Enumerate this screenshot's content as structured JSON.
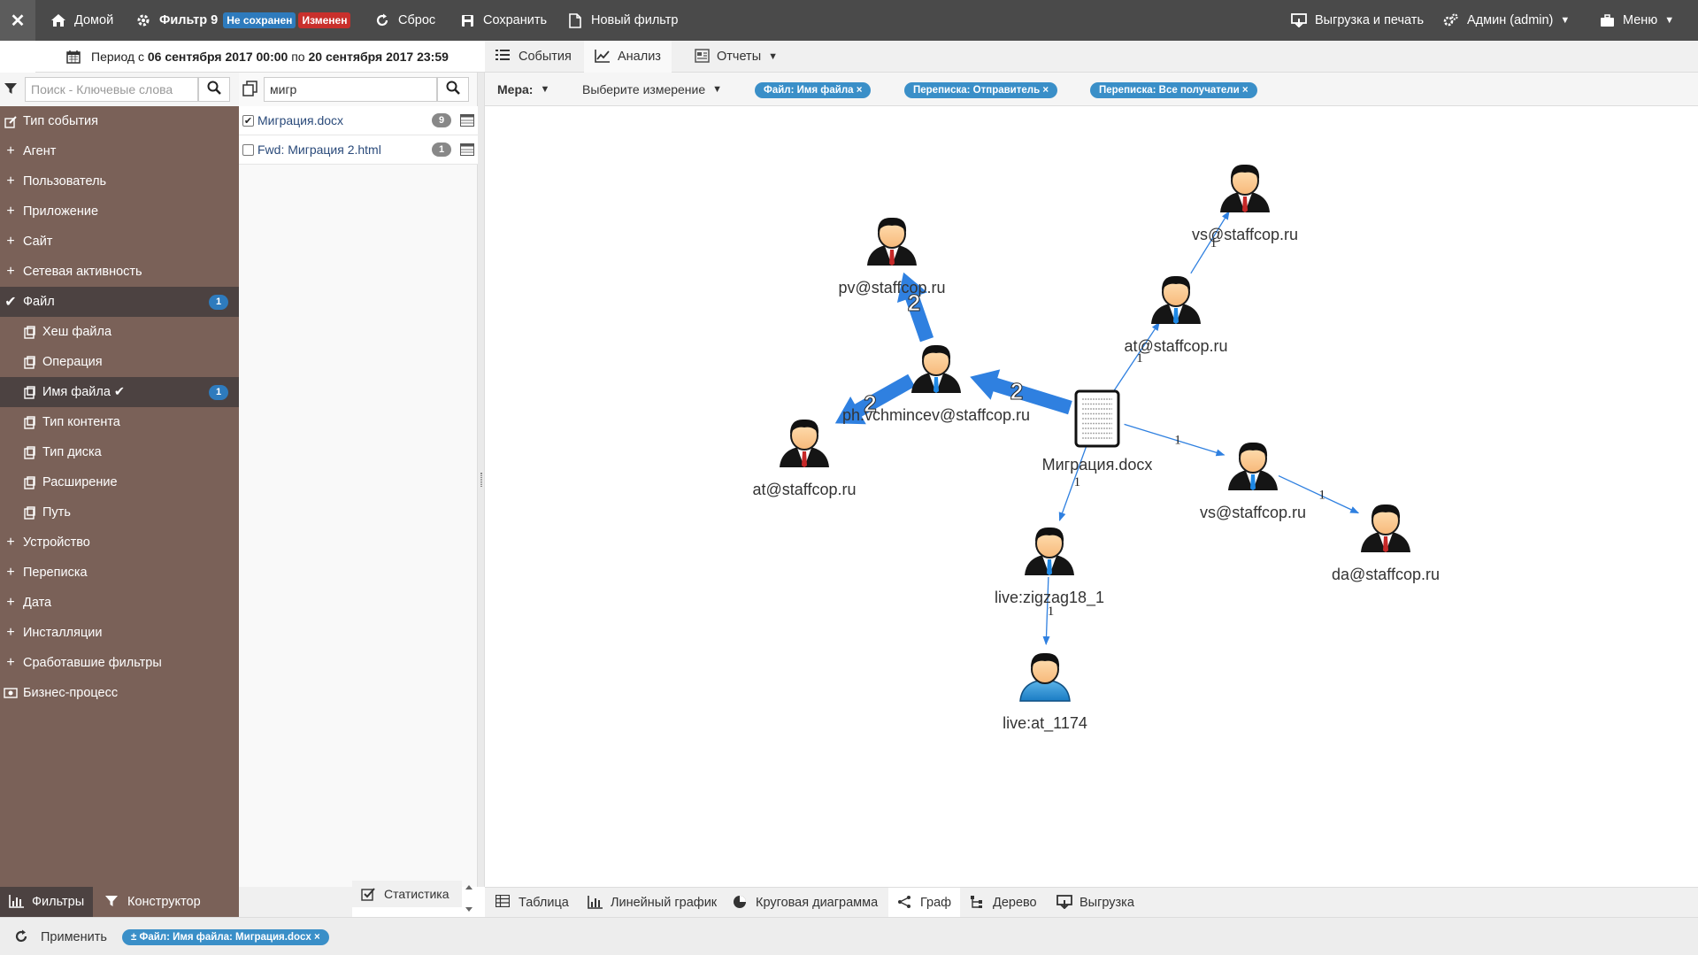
{
  "topbar": {
    "close_icon": "close-icon",
    "home_label": "Домой",
    "filter_label": "Фильтр 9",
    "badge_not_saved": "Не сохранен",
    "badge_changed": "Изменен",
    "reset_label": "Сброс",
    "save_label": "Сохранить",
    "new_filter_label": "Новый фильтр",
    "export_print_label": "Выгрузка и печать",
    "admin_label": "Админ (admin)",
    "menu_label": "Меню"
  },
  "period": {
    "prefix": "Период с",
    "from": "06 сентября 2017 00:00",
    "middle": "по",
    "to": "20 сентября 2017 23:59"
  },
  "subtabs": {
    "events": "События",
    "analysis": "Анализ",
    "reports": "Отчеты"
  },
  "sidebar": {
    "search_placeholder": "Поиск - Ключевые слова",
    "items": [
      {
        "label": "Тип события",
        "type": "icon-edit"
      },
      {
        "label": "Агент",
        "type": "plus"
      },
      {
        "label": "Пользователь",
        "type": "plus"
      },
      {
        "label": "Приложение",
        "type": "plus"
      },
      {
        "label": "Сайт",
        "type": "plus"
      },
      {
        "label": "Сетевая активность",
        "type": "plus"
      },
      {
        "label": "Файл",
        "type": "check",
        "count": "1"
      },
      {
        "label": "Хеш файла",
        "type": "sub"
      },
      {
        "label": "Операция",
        "type": "sub"
      },
      {
        "label": "Имя файла ✔",
        "type": "sub-active",
        "count": "1"
      },
      {
        "label": "Тип контента",
        "type": "sub"
      },
      {
        "label": "Тип диска",
        "type": "sub"
      },
      {
        "label": "Расширение",
        "type": "sub"
      },
      {
        "label": "Путь",
        "type": "sub"
      },
      {
        "label": "Устройство",
        "type": "plus"
      },
      {
        "label": "Переписка",
        "type": "plus"
      },
      {
        "label": "Дата",
        "type": "plus"
      },
      {
        "label": "Инсталляции",
        "type": "plus"
      },
      {
        "label": "Сработавшие фильтры",
        "type": "plus"
      },
      {
        "label": "Бизнес-процесс",
        "type": "icon-money"
      }
    ]
  },
  "midpanel": {
    "search_value": "мигр",
    "items": [
      {
        "label": "Миграция.docx",
        "count": "9",
        "checked": true
      },
      {
        "label": "Fwd: Миграция 2.html",
        "count": "1",
        "checked": false
      }
    ],
    "statistics_label": "Статистика"
  },
  "measurebar": {
    "measure_label": "Мера:",
    "dimension_label": "Выберите измерение",
    "chips": [
      "Файл: Имя файла ×",
      "Переписка: Отправитель ×",
      "Переписка: Все получатели ×"
    ]
  },
  "graph": {
    "nodes": [
      {
        "id": "pv",
        "label": "pv@staffcop.ru",
        "kind": "person-red"
      },
      {
        "id": "ph",
        "label": "ph.vchmincev@staffcop.ru",
        "kind": "person-blue"
      },
      {
        "id": "at1",
        "label": "at@staffcop.ru",
        "kind": "person-red"
      },
      {
        "id": "doc",
        "label": "Миграция.docx",
        "kind": "document"
      },
      {
        "id": "at2",
        "label": "at@staffcop.ru",
        "kind": "person-blue"
      },
      {
        "id": "vs1",
        "label": "vs@staffcop.ru",
        "kind": "person-red"
      },
      {
        "id": "vs2",
        "label": "vs@staffcop.ru",
        "kind": "person-blue"
      },
      {
        "id": "da",
        "label": "da@staffcop.ru",
        "kind": "person-red"
      },
      {
        "id": "lz",
        "label": "live:zigzag18_1",
        "kind": "person-blue"
      },
      {
        "id": "la",
        "label": "live:at_1174",
        "kind": "person-skype"
      }
    ],
    "edges": [
      {
        "from": "ph",
        "to": "pv",
        "weight": "2"
      },
      {
        "from": "ph",
        "to": "at1",
        "weight": "2"
      },
      {
        "from": "doc",
        "to": "ph",
        "weight": "2"
      },
      {
        "from": "doc",
        "to": "at2",
        "weight": "1"
      },
      {
        "from": "at2",
        "to": "vs1",
        "weight": "1"
      },
      {
        "from": "doc",
        "to": "vs2",
        "weight": "1"
      },
      {
        "from": "vs2",
        "to": "da",
        "weight": "1"
      },
      {
        "from": "doc",
        "to": "lz",
        "weight": "1"
      },
      {
        "from": "lz",
        "to": "la",
        "weight": "1"
      }
    ]
  },
  "bottomtabs": {
    "table": "Таблица",
    "line_chart": "Линейный график",
    "pie_chart": "Круговая диаграмма",
    "graph": "Граф",
    "tree": "Дерево",
    "export": "Выгрузка"
  },
  "leftbottom": {
    "filters": "Фильтры",
    "constructor": "Конструктор"
  },
  "applybar": {
    "apply_label": "Применить",
    "chip": "± Файл: Имя файла: Миграция.docx ×"
  },
  "colors": {
    "topbar": "#4a4a4a",
    "sidebar": "#7a6158",
    "sidebar_active": "#4c4241",
    "accent": "#2e7bbd",
    "edge": "#2f80e0"
  }
}
